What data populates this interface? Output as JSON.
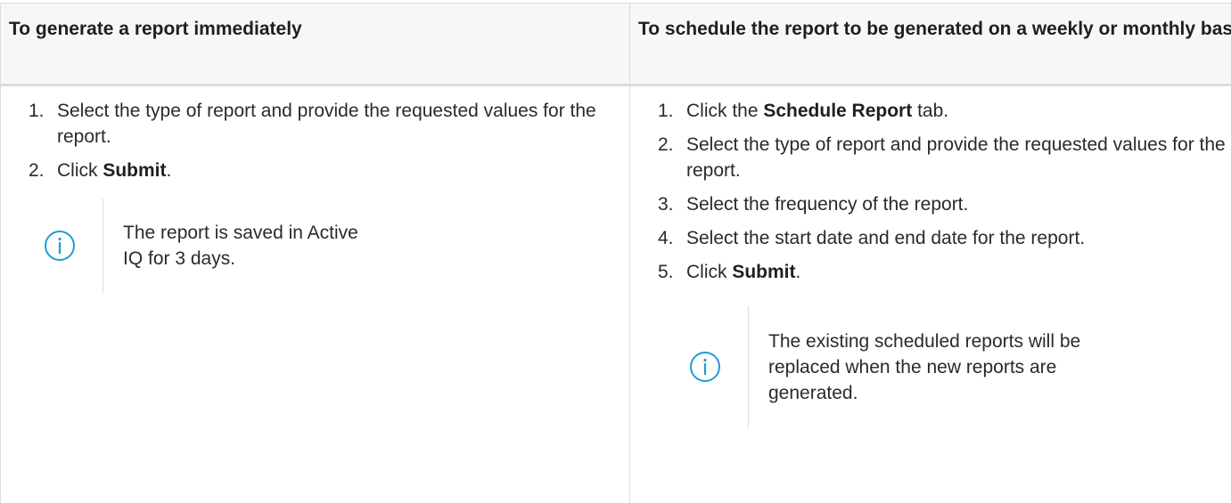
{
  "header": {
    "left": "To generate a report immediately",
    "right": "To schedule the report to be generated on a weekly or monthly basis"
  },
  "left_column": {
    "steps": [
      {
        "num": "1.",
        "pre": "Select the type of report and provide the requested values for the report.",
        "bold": "",
        "post": ""
      },
      {
        "num": "2.",
        "pre": "Click ",
        "bold": "Submit",
        "post": "."
      }
    ],
    "note": {
      "icon": "info-circle-icon",
      "text": "The report is saved in Active IQ for 3 days."
    }
  },
  "right_column": {
    "steps": [
      {
        "num": "1.",
        "pre": "Click the ",
        "bold": "Schedule Report",
        "post": " tab."
      },
      {
        "num": "2.",
        "pre": "Select the type of report and provide the requested values for the report.",
        "bold": "",
        "post": ""
      },
      {
        "num": "3.",
        "pre": "Select the frequency of the report.",
        "bold": "",
        "post": ""
      },
      {
        "num": "4.",
        "pre": "Select the start date and end date for the report.",
        "bold": "",
        "post": ""
      },
      {
        "num": "5.",
        "pre": "Click ",
        "bold": "Submit",
        "post": "."
      }
    ],
    "note": {
      "icon": "info-circle-icon",
      "text": "The existing scheduled reports will be replaced when the new reports are generated."
    }
  },
  "colors": {
    "icon": "#1a9fd6",
    "border": "#dcdcdc",
    "header_bg": "#f7f7f7",
    "text": "#1f1f1f"
  }
}
